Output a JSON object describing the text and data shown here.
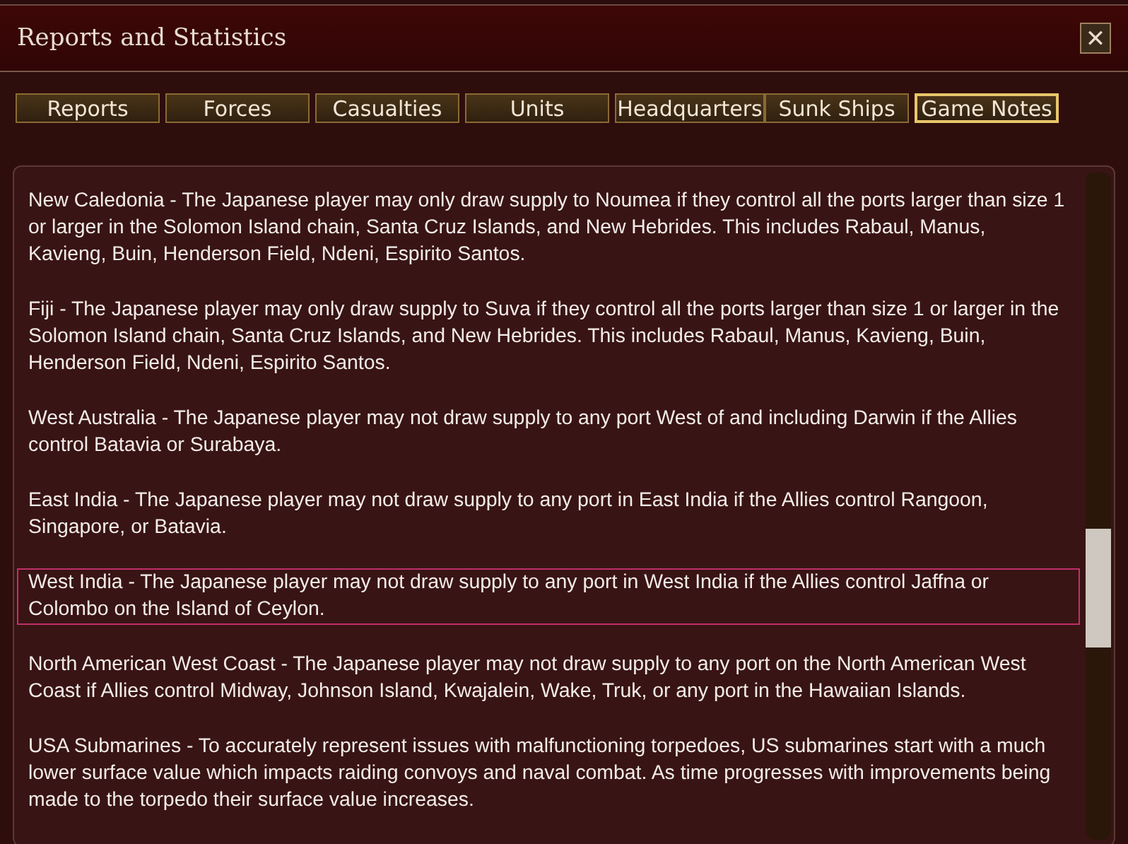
{
  "window": {
    "title": "Reports and Statistics",
    "close": "✕"
  },
  "tabs": [
    {
      "label": "Reports",
      "selected": false
    },
    {
      "label": "Forces",
      "selected": false
    },
    {
      "label": "Casualties",
      "selected": false
    },
    {
      "label": "Units",
      "selected": false
    },
    {
      "label": "Headquarters",
      "selected": false
    },
    {
      "label": "Sunk Ships",
      "selected": false
    },
    {
      "label": "Game Notes",
      "selected": true
    }
  ],
  "notes": [
    {
      "text": "New Caledonia - The Japanese player may only draw supply to Noumea if they control all the ports larger than size 1 or larger in the Solomon Island chain, Santa Cruz Islands, and New Hebrides. This includes Rabaul, Manus, Kavieng, Buin, Henderson Field, Ndeni, Espirito Santos.",
      "selected": false
    },
    {
      "text": "Fiji - The Japanese player may only draw supply to Suva if they control all the ports larger than size 1 or larger in the Solomon Island chain, Santa Cruz Islands, and New Hebrides. This includes Rabaul, Manus, Kavieng, Buin, Henderson Field, Ndeni, Espirito Santos.",
      "selected": false
    },
    {
      "text": "West Australia - The Japanese player may not draw supply to any port West of and including Darwin if the Allies control Batavia or Surabaya.",
      "selected": false
    },
    {
      "text": "East India - The Japanese player may not draw supply to any port in East India if the Allies control Rangoon, Singapore, or Batavia.",
      "selected": false
    },
    {
      "text": "West India - The Japanese player may not draw supply to any port in West India if the Allies control Jaffna or Colombo on the Island of Ceylon.",
      "selected": true
    },
    {
      "text": "North American West Coast - The Japanese player may not draw supply to any port on the North American West Coast if Allies control Midway, Johnson Island, Kwajalein, Wake, Truk, or any port in the Hawaiian Islands.",
      "selected": false
    },
    {
      "text": "USA Submarines - To accurately represent issues with malfunctioning torpedoes, US submarines start with a much lower surface value which impacts raiding convoys and naval combat. As time progresses with improvements being made to the torpedo their surface value increases.",
      "selected": false
    }
  ]
}
